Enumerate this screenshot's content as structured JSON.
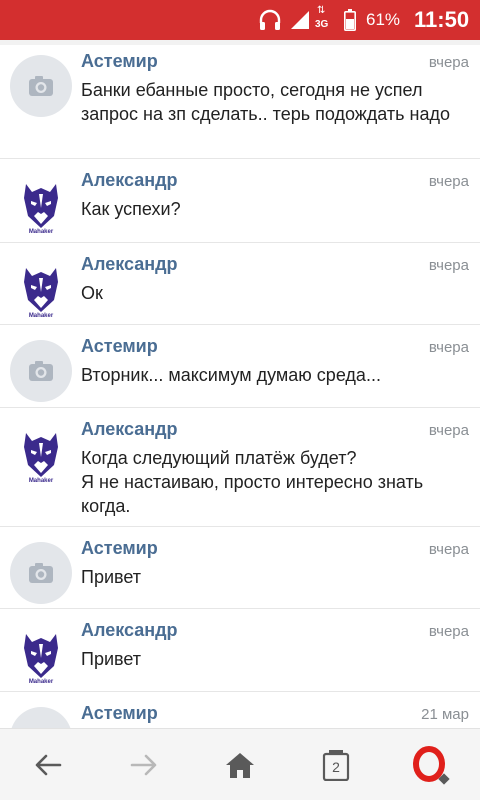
{
  "status_bar": {
    "network_type": "3G",
    "battery_percent": "61%",
    "time": "11:50",
    "icons": [
      "headset-icon",
      "signal-icon",
      "network-icon",
      "battery-icon"
    ]
  },
  "messages": [
    {
      "sender": "Астемир",
      "date": "вчера",
      "text": "Банки ебанные просто, сегодня не успел запрос на зп сделать.. терь подождать надо",
      "avatar": "camera"
    },
    {
      "sender": "Александр",
      "date": "вчера",
      "text": "Как успехи?",
      "avatar": "wolf"
    },
    {
      "sender": "Александр",
      "date": "вчера",
      "text": "Ок",
      "avatar": "wolf"
    },
    {
      "sender": "Астемир",
      "date": "вчера",
      "text": "Вторник... максимум думаю среда...",
      "avatar": "camera"
    },
    {
      "sender": "Александр",
      "date": "вчера",
      "text": "Когда следующий платёж будет?\nЯ не настаиваю, просто интересно знать когда.",
      "avatar": "wolf"
    },
    {
      "sender": "Астемир",
      "date": "вчера",
      "text": "Привет",
      "avatar": "camera"
    },
    {
      "sender": "Александр",
      "date": "вчера",
      "text": "Привет",
      "avatar": "wolf"
    },
    {
      "sender": "Астемир",
      "date": "21 мар",
      "text": "",
      "avatar": "camera"
    }
  ],
  "avatar_logo_text": "Mahaker",
  "bottom_nav": {
    "tabs_count": "2",
    "icons": [
      "back-arrow-icon",
      "forward-arrow-icon",
      "home-icon",
      "tabs-icon",
      "opera-icon"
    ]
  },
  "colors": {
    "status_bar": "#d32f2f",
    "sender_name": "#4a6d93",
    "date": "#8a8f94",
    "message_text": "#222222",
    "wolf_logo": "#3b2a8c",
    "opera_red": "#e0201b"
  }
}
